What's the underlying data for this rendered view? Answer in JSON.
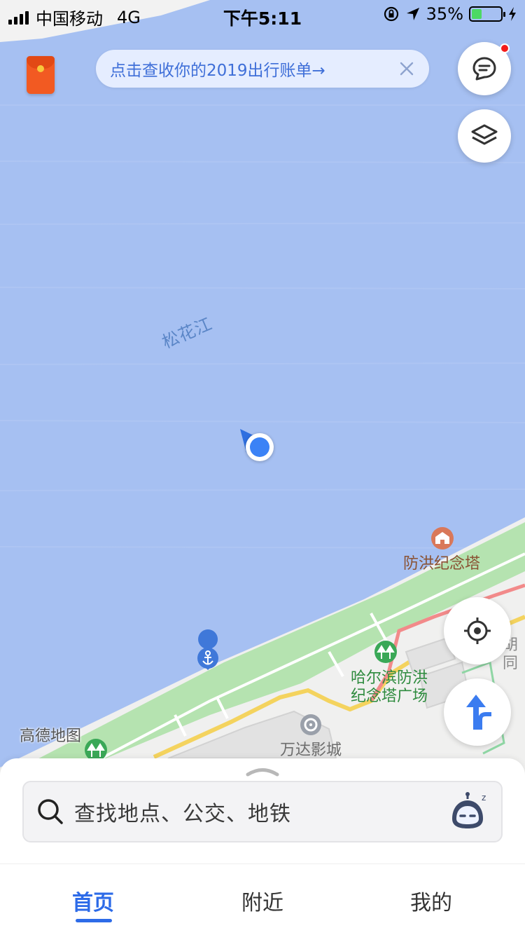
{
  "status_bar": {
    "carrier": "中国移动",
    "network": "4G",
    "time": "下午5:11",
    "battery_percent": "35%",
    "battery_level": 0.35
  },
  "promo": {
    "text": "点击查收你的2019出行账单→"
  },
  "map": {
    "river_label": "松花江",
    "flood_tower": "防洪纪念塔",
    "plaza_line1": "哈尔滨防洪",
    "plaza_line2": "纪念塔广场",
    "cinema": "万达影城",
    "hutong": "胡同",
    "brand": "高德地图"
  },
  "search": {
    "placeholder": "查找地点、公交、地铁"
  },
  "tabs": [
    {
      "label": "首页",
      "active": true
    },
    {
      "label": "附近",
      "active": false
    },
    {
      "label": "我的",
      "active": false
    }
  ],
  "colors": {
    "water": "#a6c0f2",
    "park": "#b5e3b0",
    "accent": "#2d6be8",
    "notification": "#f41b1b"
  },
  "icons": [
    "red-envelope-icon",
    "close-icon",
    "message-icon",
    "layers-icon",
    "locate-icon",
    "route-icon",
    "search-icon",
    "assistant-icon",
    "anchor-icon",
    "monument-icon",
    "park-icon",
    "cinema-icon"
  ]
}
